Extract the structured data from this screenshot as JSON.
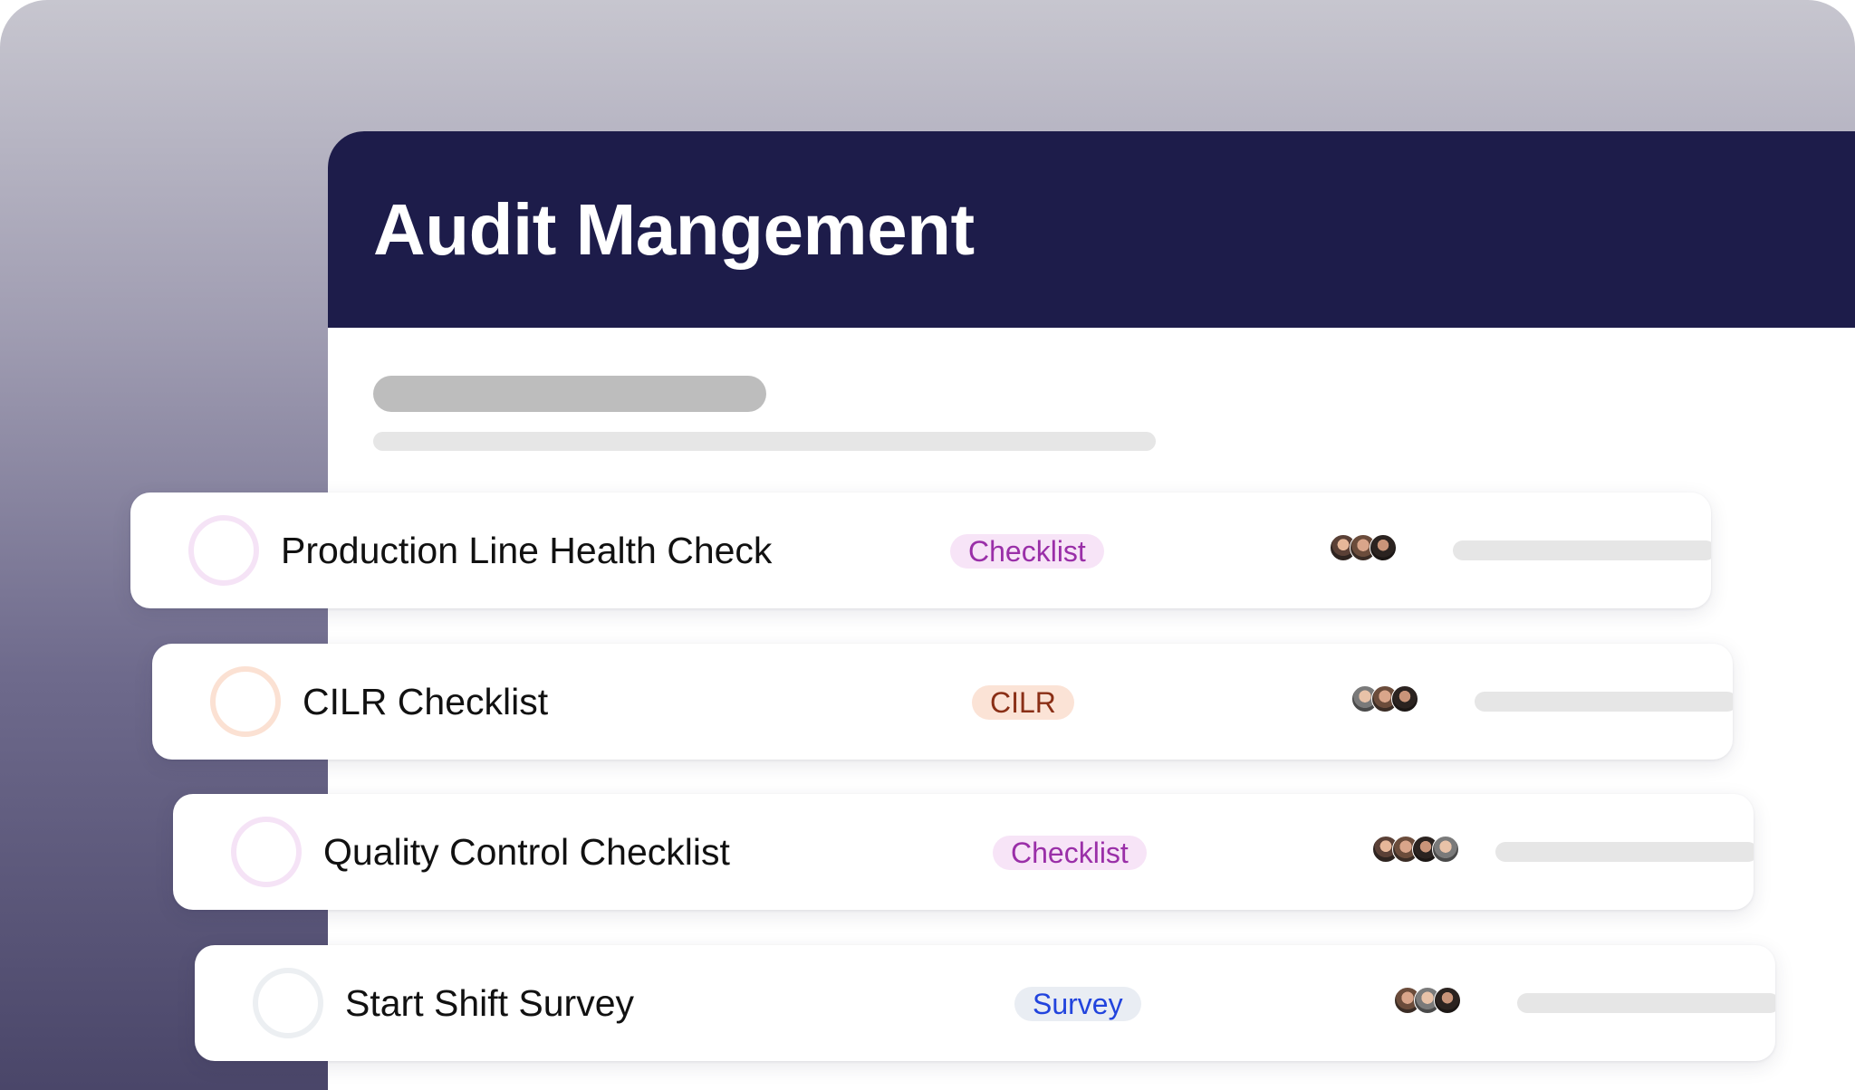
{
  "header": {
    "title": "Audit Mangement"
  },
  "colors": {
    "header_bg": "#1d1c4a",
    "checklist_tag_bg": "#f7e4f7",
    "checklist_tag_text": "#9a2fa8",
    "cilr_tag_bg": "#fbe3d6",
    "cilr_tag_text": "#8a2f16",
    "survey_tag_bg": "#e9edf3",
    "survey_tag_text": "#2244dd"
  },
  "audits": [
    {
      "title": "Production Line Health Check",
      "tag": "Checklist",
      "status_ring_color": "#f5e3f6",
      "assignee_avatars": 3
    },
    {
      "title": "CILR Checklist",
      "tag": "CILR",
      "status_ring_color": "#fbe1d3",
      "assignee_avatars": 3
    },
    {
      "title": "Quality Control Checklist",
      "tag": "Checklist",
      "status_ring_color": "#f5e3f6",
      "assignee_avatars": 4
    },
    {
      "title": "Start Shift Survey",
      "tag": "Survey",
      "status_ring_color": "#eceff2",
      "assignee_avatars": 3
    }
  ]
}
